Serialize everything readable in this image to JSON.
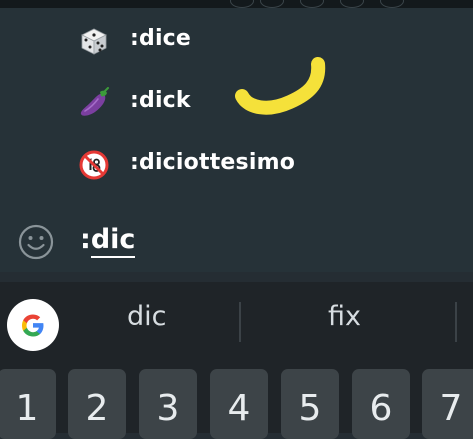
{
  "emoji_suggestions": [
    {
      "label": ":dice",
      "icon": "dice-icon"
    },
    {
      "label": ":dick",
      "icon": "eggplant-icon"
    },
    {
      "label": ":diciottesimo",
      "icon": "no-under-18-icon"
    }
  ],
  "input": {
    "prefix": ":",
    "typed": "dic",
    "icon": "smiley-icon"
  },
  "suggestion_strip": {
    "logo": "google-g-icon",
    "words": [
      "dic",
      "fix"
    ]
  },
  "number_keys": [
    "1",
    "2",
    "3",
    "4",
    "5",
    "6",
    "7"
  ],
  "colors": {
    "panel": "#263238",
    "keyboard": "#1f2428",
    "key": "#3d4448",
    "highlight_scribble": "#f5e13a"
  }
}
